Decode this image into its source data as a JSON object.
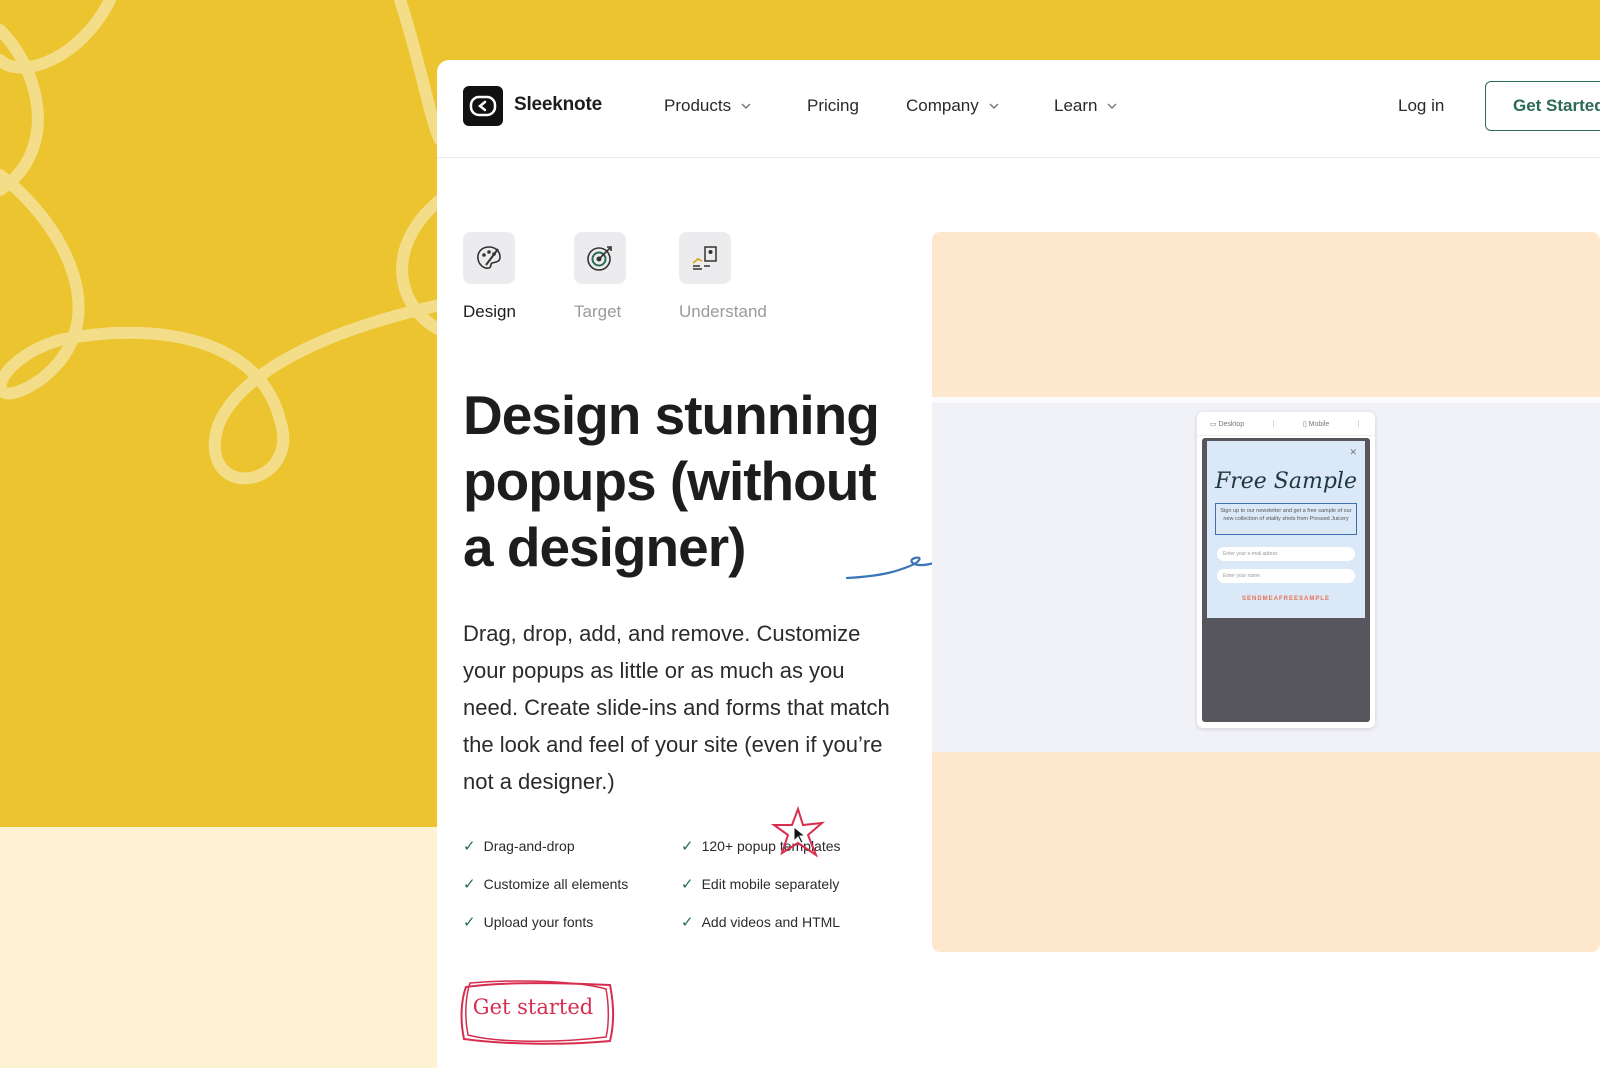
{
  "nav": {
    "brand": "Sleeknote",
    "items": [
      {
        "label": "Products"
      },
      {
        "label": "Pricing"
      },
      {
        "label": "Company"
      },
      {
        "label": "Learn"
      }
    ],
    "login": "Log in",
    "cta": "Get Started"
  },
  "tabs": [
    {
      "label": "Design",
      "icon": "palette-icon"
    },
    {
      "label": "Target",
      "icon": "target-icon"
    },
    {
      "label": "Understand",
      "icon": "report-icon"
    }
  ],
  "hero": {
    "headline": "Design stunning popups (without a designer)",
    "body": "Drag, drop, add, and remove. Customize your popups as little or as much as you need. Create slide-ins and forms that match the look and feel of your site (even if you’re not a designer.)",
    "features": [
      "Drag-and-drop",
      "120+ popup templates",
      "Customize all elements",
      "Edit mobile separately",
      "Upload your fonts",
      "Add videos and HTML"
    ],
    "cta": "Get started"
  },
  "preview": {
    "toolbar_desktop": "Desktop",
    "toolbar_mobile": "Mobile",
    "popup_title": "Free Sample",
    "popup_desc": "Sign up to our newsletter and get a free sample of our new collection of vitality shots from Pressed Juicery",
    "email_placeholder": "Enter your e-mail adress",
    "name_placeholder": "Enter your name",
    "popup_button": "SENDMEAFREESAMPLE"
  },
  "colors": {
    "background_yellow": "#ecc430",
    "cream": "#fdf2d1",
    "accent_green": "#2b6a57",
    "cta_red": "#d72d4f",
    "preview_peach": "#fee8cd"
  }
}
